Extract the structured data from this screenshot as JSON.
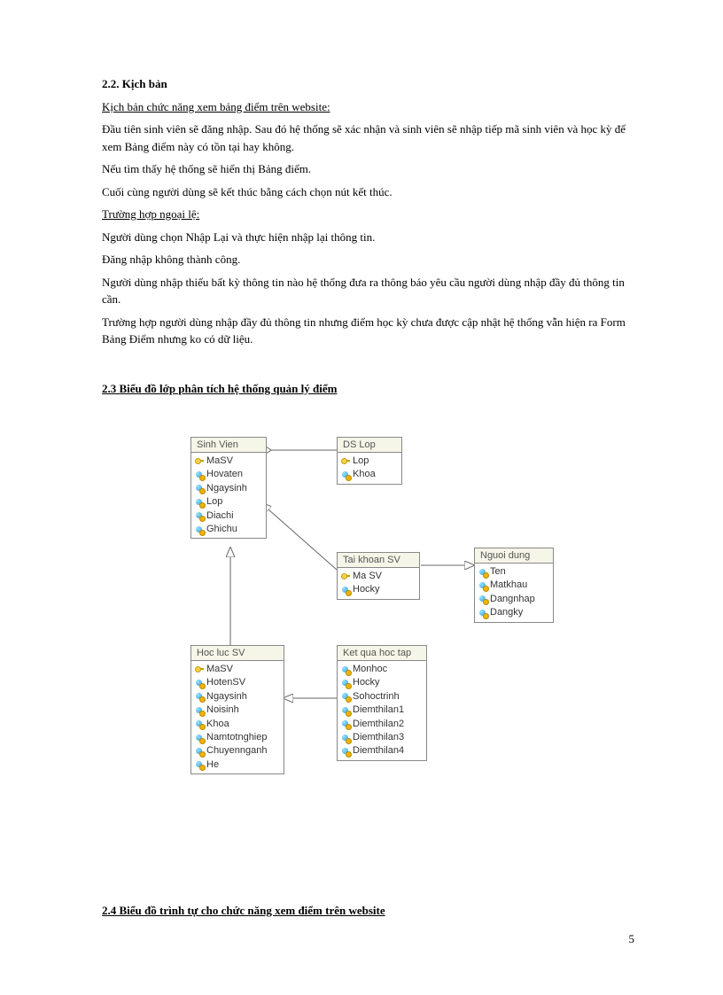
{
  "sections": {
    "s22_title": "2.2. Kịch bản",
    "s22_subtitle": "Kịch bản chức năng xem bảng điểm trên website:",
    "s22_p1": "Đầu tiên sinh viên sẽ đăng nhập. Sau đó hệ thống sẽ xác nhận và sinh viên sẽ nhập tiếp mã sinh viên và học kỳ để xem Bảng điểm này có tồn tại hay không.",
    "s22_p2": "Nếu tìm thấy hệ thống sẽ hiển thị Bảng điểm.",
    "s22_p3": "Cuối cùng người dùng sẽ kết thúc bằng cách chọn nút kết thúc.",
    "s22_except_title": "Trường hợp ngoại lệ:",
    "s22_e1": "Người dùng chọn Nhập Lại và thực hiện nhập lại thông tin.",
    "s22_e2": "Đăng nhập không thành công.",
    "s22_e3": "Người dùng nhập thiếu bất kỳ thông tin nào hệ thống đưa ra thông báo yêu cầu người dùng nhập đầy đủ thông tin cần.",
    "s22_e4": "Trường hợp người dùng nhập đầy đủ thông tin nhưng điểm học kỳ chưa được cập nhật hệ thống vẫn hiện ra Form Bảng Điểm nhưng ko có dữ liệu.",
    "s23_title": "2.3 Biểu đồ lớp phân tích hệ thống quản lý điểm",
    "s24_title": "2.4 Biểu đồ trình tự cho chức năng xem điểm trên website"
  },
  "classes": {
    "sinhvien": {
      "title": "Sinh Vien",
      "attrs": [
        {
          "icon": "key",
          "name": "MaSV"
        },
        {
          "icon": "attr",
          "name": "Hovaten"
        },
        {
          "icon": "attr",
          "name": "Ngaysinh"
        },
        {
          "icon": "attr",
          "name": "Lop"
        },
        {
          "icon": "attr",
          "name": "Diachi"
        },
        {
          "icon": "attr",
          "name": "Ghichu"
        }
      ]
    },
    "dslop": {
      "title": "DS Lop",
      "attrs": [
        {
          "icon": "key",
          "name": "Lop"
        },
        {
          "icon": "attr",
          "name": "Khoa"
        }
      ]
    },
    "taikhoansv": {
      "title": "Tai khoan SV",
      "attrs": [
        {
          "icon": "key",
          "name": "Ma SV"
        },
        {
          "icon": "attr",
          "name": "Hocky"
        }
      ]
    },
    "nguoidung": {
      "title": "Nguoi dung",
      "attrs": [
        {
          "icon": "attr",
          "name": "Ten"
        },
        {
          "icon": "attr",
          "name": "Matkhau"
        },
        {
          "icon": "attr",
          "name": "Dangnhap"
        },
        {
          "icon": "attr",
          "name": "Dangky"
        }
      ]
    },
    "hoclucsv": {
      "title": "Hoc luc SV",
      "attrs": [
        {
          "icon": "key",
          "name": "MaSV"
        },
        {
          "icon": "attr",
          "name": "HotenSV"
        },
        {
          "icon": "attr",
          "name": "Ngaysinh"
        },
        {
          "icon": "attr",
          "name": "Noisinh"
        },
        {
          "icon": "attr",
          "name": "Khoa"
        },
        {
          "icon": "attr",
          "name": "Namtotnghiep"
        },
        {
          "icon": "attr",
          "name": "Chuyennganh"
        },
        {
          "icon": "attr",
          "name": "He"
        }
      ]
    },
    "ketquahoctap": {
      "title": "Ket qua hoc tap",
      "attrs": [
        {
          "icon": "attr",
          "name": "Monhoc"
        },
        {
          "icon": "attr",
          "name": "Hocky"
        },
        {
          "icon": "attr",
          "name": "Sohoctrinh"
        },
        {
          "icon": "attr",
          "name": "Diemthilan1"
        },
        {
          "icon": "attr",
          "name": "Diemthilan2"
        },
        {
          "icon": "attr",
          "name": "Diemthilan3"
        },
        {
          "icon": "attr",
          "name": "Diemthilan4"
        }
      ]
    }
  },
  "page_number": "5"
}
